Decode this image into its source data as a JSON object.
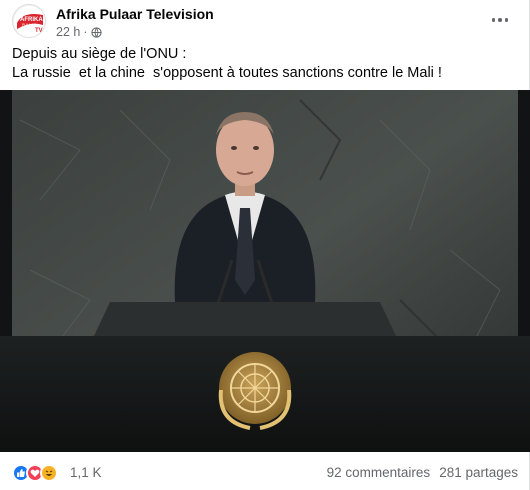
{
  "post": {
    "page_name": "Afrika Pulaar Television",
    "timestamp": "22 h",
    "separator": "·",
    "visibility_icon": "globe-icon",
    "avatar_logo_text": [
      "AFRIKA",
      "PULAAR",
      "TV"
    ],
    "text_line1": "Depuis au siège de l'ONU :",
    "text_line2": "La russie  et la chine  s'opposent à toutes sanctions contre le Mali !"
  },
  "footer": {
    "reactions": [
      "like-icon",
      "love-icon",
      "haha-icon"
    ],
    "reaction_count": "1,1 K",
    "comments": "92 commentaires",
    "shares": "281 partages"
  },
  "colors": {
    "like": "#1877f2",
    "love": "#f33e58",
    "haha": "#f7b125",
    "secondary_text": "#65676b",
    "logo_red": "#d9232d"
  }
}
